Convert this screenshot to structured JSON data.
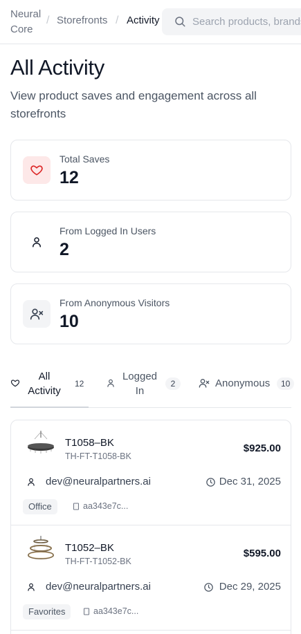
{
  "breadcrumb": {
    "root": "Neural Core",
    "storefronts": "Storefronts",
    "current": "Activity",
    "separator": "/"
  },
  "search": {
    "placeholder": "Search products, brands"
  },
  "page": {
    "title": "All Activity",
    "subtitle": "View product saves and engagement across all storefronts"
  },
  "stats": [
    {
      "label": "Total Saves",
      "value": "12",
      "icon": "heart-icon"
    },
    {
      "label": "From Logged In Users",
      "value": "2",
      "icon": "user-icon"
    },
    {
      "label": "From Anonymous Visitors",
      "value": "10",
      "icon": "user-x-icon"
    }
  ],
  "tabs": [
    {
      "label": "All Activity",
      "count": "12",
      "icon": "heart-icon",
      "active": true
    },
    {
      "label": "Logged In",
      "count": "2",
      "icon": "user-icon",
      "active": false
    },
    {
      "label": "Anonymous",
      "count": "10",
      "icon": "user-x-icon",
      "active": false
    }
  ],
  "items": [
    {
      "sku": "T1058–BK",
      "code": "TH-FT-T1058-BK",
      "price": "$925.00",
      "user": "dev@neuralpartners.ai",
      "date": "Dec 31, 2025",
      "tag": "Office",
      "store": "aa343e7c..."
    },
    {
      "sku": "T1052–BK",
      "code": "TH-FT-T1052-BK",
      "price": "$595.00",
      "user": "dev@neuralpartners.ai",
      "date": "Dec 29, 2025",
      "tag": "Favorites",
      "store": "aa343e7c..."
    }
  ],
  "colors": {
    "heart_bg": "#fde8e8",
    "heart_stroke": "#dc2626",
    "neutral_bg": "#f3f4f6",
    "border": "#e5e7eb"
  }
}
